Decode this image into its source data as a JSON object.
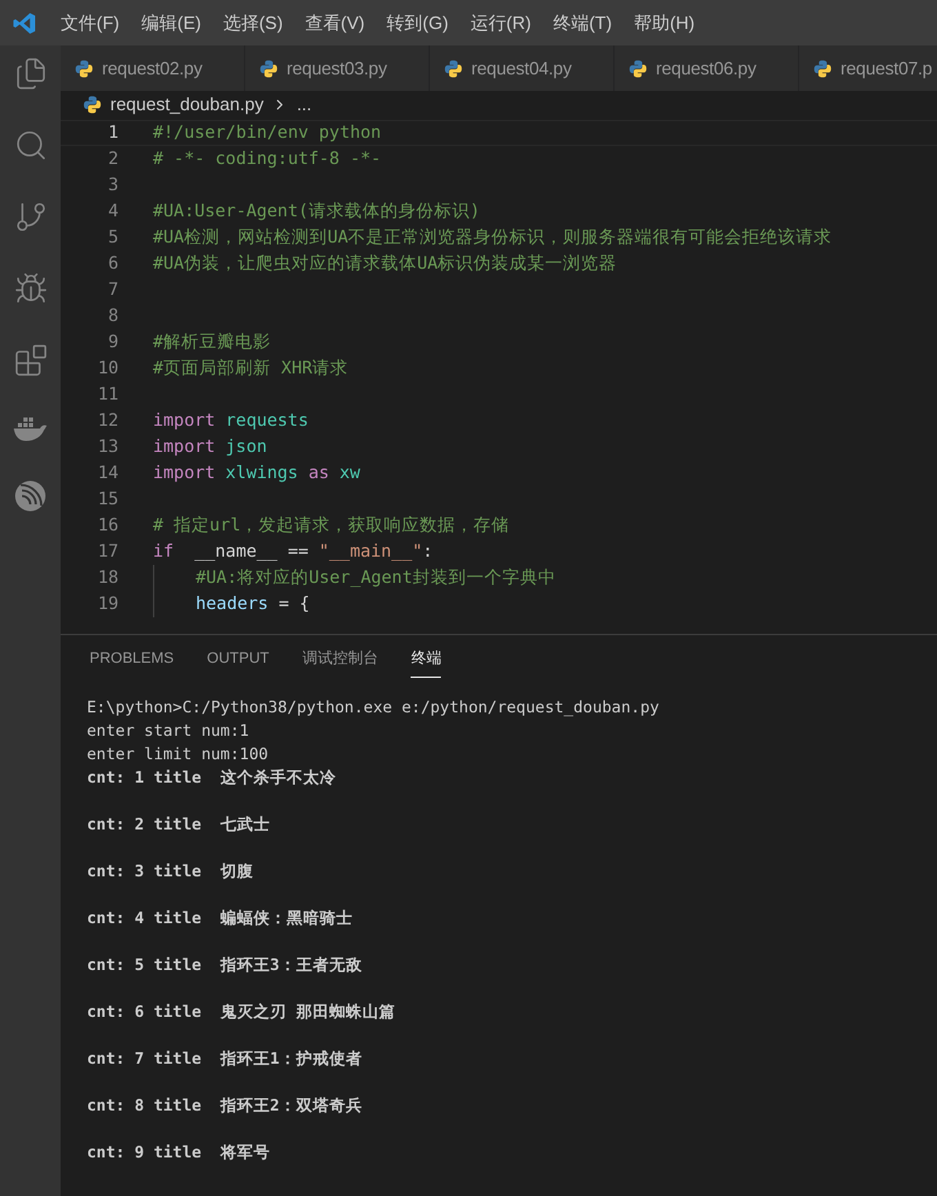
{
  "menu": [
    "文件(F)",
    "编辑(E)",
    "选择(S)",
    "查看(V)",
    "转到(G)",
    "运行(R)",
    "终端(T)",
    "帮助(H)"
  ],
  "tabs": [
    {
      "label": "request02.py",
      "selected": false
    },
    {
      "label": "request03.py",
      "selected": false
    },
    {
      "label": "request04.py",
      "selected": false
    },
    {
      "label": "request06.py",
      "selected": false
    },
    {
      "label": "request07.p",
      "selected": false
    }
  ],
  "breadcrumb": {
    "file": "request_douban.py",
    "trail": "..."
  },
  "editor": {
    "lines": [
      {
        "number": "1",
        "active": true,
        "tokens": [
          {
            "kind": "comment",
            "text": "#!/user/bin/env python"
          }
        ]
      },
      {
        "number": "2",
        "active": false,
        "tokens": [
          {
            "kind": "comment",
            "text": "# -*- coding:utf-8 -*-"
          }
        ]
      },
      {
        "number": "3",
        "active": false
      },
      {
        "number": "4",
        "active": false,
        "tokens": [
          {
            "kind": "comment",
            "text": "#UA:User-Agent(请求载体的身份标识)"
          }
        ]
      },
      {
        "number": "5",
        "active": false,
        "tokens": [
          {
            "kind": "comment",
            "text": "#UA检测，网站检测到UA不是正常浏览器身份标识，则服务器端很有可能会拒绝该请求"
          }
        ]
      },
      {
        "number": "6",
        "active": false,
        "tokens": [
          {
            "kind": "comment",
            "text": "#UA伪装，让爬虫对应的请求载体UA标识伪装成某一浏览器"
          }
        ]
      },
      {
        "number": "7",
        "active": false
      },
      {
        "number": "8",
        "active": false
      },
      {
        "number": "9",
        "active": false,
        "tokens": [
          {
            "kind": "comment",
            "text": "#解析豆瓣电影"
          }
        ]
      },
      {
        "number": "10",
        "active": false,
        "tokens": [
          {
            "kind": "comment",
            "text": "#页面局部刷新 XHR请求"
          }
        ]
      },
      {
        "number": "11",
        "active": false
      },
      {
        "number": "12",
        "active": false,
        "tokens": [
          {
            "kind": "keyword",
            "text": "import"
          },
          {
            "kind": "module",
            "text": "requests"
          }
        ]
      },
      {
        "number": "13",
        "active": false,
        "tokens": [
          {
            "kind": "keyword",
            "text": "import"
          },
          {
            "kind": "module",
            "text": "json"
          }
        ]
      },
      {
        "number": "14",
        "active": false,
        "tokens": [
          {
            "kind": "keyword",
            "text": "import"
          },
          {
            "kind": "module",
            "text": "xlwings"
          },
          {
            "kind": "keyword",
            "text": "as"
          },
          {
            "kind": "module",
            "text": "xw"
          }
        ]
      },
      {
        "number": "15",
        "active": false
      },
      {
        "number": "16",
        "active": false,
        "tokens": [
          {
            "kind": "comment",
            "text": "# 指定url，发起请求，获取响应数据，存储"
          }
        ]
      },
      {
        "number": "17",
        "active": false,
        "tokens": [
          {
            "kind": "keyword",
            "text": "if"
          },
          {
            "kind": "plain",
            "text": " __name__ =="
          },
          {
            "kind": "string",
            "text": "\"__main__\""
          },
          {
            "kind": "glued",
            "text": ":"
          }
        ]
      },
      {
        "number": "18",
        "active": false,
        "indent_guide": true,
        "tokens": [
          {
            "kind": "comment",
            "text": "#UA:将对应的User_Agent封装到一个字典中"
          }
        ]
      },
      {
        "number": "19",
        "active": false,
        "indent_guide": true,
        "tokens": [
          {
            "kind": "variable",
            "text": "headers"
          },
          {
            "kind": "plain",
            "text": "= {"
          }
        ]
      }
    ]
  },
  "panel": {
    "tabs": [
      {
        "label": "PROBLEMS",
        "selected": false
      },
      {
        "label": "OUTPUT",
        "selected": false
      },
      {
        "label": "调试控制台",
        "selected": false
      },
      {
        "label": "终端",
        "selected": true
      }
    ],
    "terminal": [
      {
        "kind": "output",
        "text": "E:\\python>C:/Python38/python.exe e:/python/request_douban.py"
      },
      {
        "kind": "output",
        "text": "enter start num:1"
      },
      {
        "kind": "output",
        "text": "enter limit num:100"
      },
      {
        "kind": "result",
        "text": "cnt: 1 title  这个杀手不太冷"
      },
      {
        "kind": "result",
        "text": "cnt: 2 title  七武士"
      },
      {
        "kind": "result",
        "text": "cnt: 3 title  切腹"
      },
      {
        "kind": "result",
        "text": "cnt: 4 title  蝙蝠侠：黑暗骑士"
      },
      {
        "kind": "result",
        "text": "cnt: 5 title  指环王3：王者无敌"
      },
      {
        "kind": "result",
        "text": "cnt: 6 title  鬼灭之刃 那田蜘蛛山篇"
      },
      {
        "kind": "result",
        "text": "cnt: 7 title  指环王1：护戒使者"
      },
      {
        "kind": "result",
        "text": "cnt: 8 title  指环王2：双塔奇兵"
      },
      {
        "kind": "result",
        "text": "cnt: 9 title  将军号"
      }
    ]
  }
}
